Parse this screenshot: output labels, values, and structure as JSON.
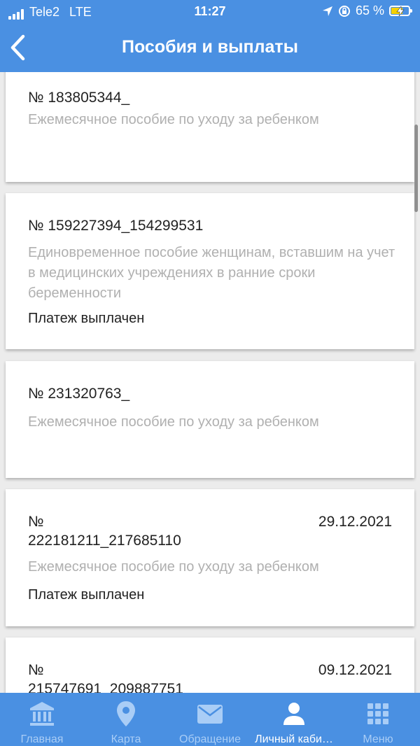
{
  "status_bar": {
    "carrier": "Tele2",
    "network": "LTE",
    "time": "11:27",
    "battery": "65 %",
    "battery_level": 0.65
  },
  "header": {
    "title": "Пособия и выплаты",
    "back_icon": "chevron-left-icon"
  },
  "cards": [
    {
      "number": "№ 183805344_",
      "date": "",
      "description": "Ежемесячное пособие по уходу за ребенком",
      "status": ""
    },
    {
      "number": "№ 159227394_154299531",
      "date": "",
      "description": "Единовременное пособие женщинам, вставшим на учет в медицинских учреждениях в ранние сроки беременности",
      "status": "Платеж выплачен"
    },
    {
      "number": "№ 231320763_",
      "date": "",
      "description": "Ежемесячное пособие по уходу за ребенком",
      "status": ""
    },
    {
      "number_line1": "№",
      "number_line2": "222181211_217685110",
      "date": "29.12.2021",
      "description": "Ежемесячное пособие по уходу за ребенком",
      "status": "Платеж выплачен"
    },
    {
      "number_line1": "№",
      "number_line2": "215747691_209887751",
      "date": "09.12.2021",
      "description": "",
      "status": ""
    }
  ],
  "tabbar": {
    "items": [
      {
        "label": "Главная",
        "icon": "bank-icon",
        "active": false
      },
      {
        "label": "Карта",
        "icon": "location-pin-icon",
        "active": false
      },
      {
        "label": "Обращение",
        "icon": "envelope-icon",
        "active": false
      },
      {
        "label": "Личный каби…",
        "icon": "user-icon",
        "active": true
      },
      {
        "label": "Меню",
        "icon": "grid-icon",
        "active": false
      }
    ]
  },
  "colors": {
    "primary": "#4a90e2",
    "tab_inactive": "#a9cdf6",
    "description_gray": "#b0b0b0",
    "battery_fill": "#f5d000"
  }
}
